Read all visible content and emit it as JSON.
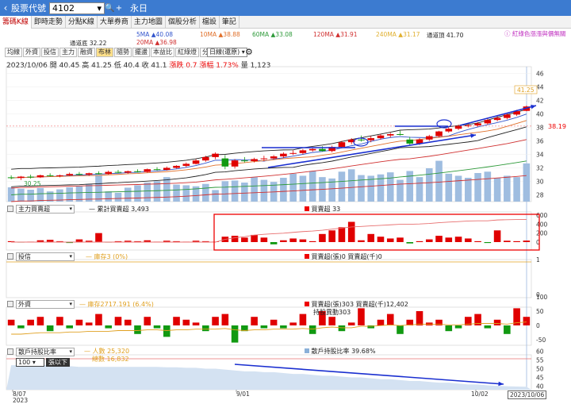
{
  "topbar": {
    "back": "‹",
    "label": "股票代號",
    "code": "4102",
    "stock_name": "永日"
  },
  "tabs": [
    "籌碼K線",
    "即時走勢",
    "分點K線",
    "大單券商",
    "主力地圖",
    "個股分析",
    "檔設",
    "筆記"
  ],
  "ma_legend": {
    "ma5": "5MA ▲40.08",
    "ma10": "10MA ▲38.88",
    "ma60": "60MA ▲33.08",
    "ma120": "120MA ▲31.91",
    "ma240": "240MA ▲31.17",
    "channel_top": "通道頂 41.70",
    "channel_bottom": "通道底 32.22",
    "ma20": "20MA ▲36.98",
    "note": "ⓘ 紅綠色漲漲與價無關"
  },
  "subtabs": [
    "均線",
    "外資",
    "投信",
    "主力",
    "融資",
    "布林",
    "隨勢",
    "擺盪",
    "本益比",
    "紅綠燈",
    "分價量"
  ],
  "period": "日線(還原)",
  "info": {
    "date": "2023/10/06",
    "open": "開 40.45",
    "high": "高 41.25",
    "low": "低 40.4",
    "close": "收 41.1",
    "change": "漲跌 0.7",
    "pct": "漲幅 1.73%",
    "volume": "量 1,123"
  },
  "price_axis": [
    "46",
    "44",
    "42",
    "40",
    "38",
    "36",
    "34",
    "32",
    "30",
    "28"
  ],
  "price_marks": {
    "high_label": "41.25",
    "current": "38.19",
    "low_label": "30.25"
  },
  "panels": {
    "main_force": {
      "select": "主力買賣超",
      "cum_label": "— 累計買賣超 3,493",
      "day_label": "買賣超 33",
      "axis": [
        "600",
        "400",
        "200",
        "0"
      ]
    },
    "trust": {
      "select": "投信",
      "hold_label": "— 庫存3 (0%)",
      "day_label": "買賣超(張)0 買賣超(千)0",
      "axis": [
        "1",
        "0"
      ]
    },
    "foreign": {
      "select": "外資",
      "hold_label": "— 庫存2717.191 (6.4%)",
      "day_label": "買賣超(張)303 買賣超(千)12,402",
      "sub_label": "持股異動303",
      "axis": [
        "100",
        "50",
        "0",
        "-50"
      ]
    },
    "holders": {
      "select": "散戶持股比率",
      "people_label": "— 人數 25,320",
      "total_label": "總數 16,832",
      "ratio_label": "散戶持股比率 39.68%",
      "axis": [
        "60",
        "55",
        "50",
        "45",
        "40"
      ],
      "pct_select": "100",
      "pct_note": "張以下"
    }
  },
  "dates": {
    "d1": "8/07",
    "d1y": "2023",
    "d2": "9/01",
    "d3": "10/02",
    "d4": "2023/10/06"
  },
  "chart_data": {
    "type": "bar",
    "candles": [
      [
        30.6,
        30.9,
        30.3,
        30.5
      ],
      [
        30.5,
        30.8,
        30.2,
        30.7
      ],
      [
        30.7,
        31.0,
        30.4,
        30.6
      ],
      [
        30.6,
        31.0,
        30.5,
        30.9
      ],
      [
        30.9,
        31.2,
        30.7,
        30.8
      ],
      [
        30.8,
        31.0,
        30.6,
        30.9
      ],
      [
        30.9,
        31.3,
        30.8,
        31.1
      ],
      [
        31.1,
        31.4,
        30.9,
        31.0
      ],
      [
        31.0,
        31.3,
        30.8,
        31.2
      ],
      [
        31.2,
        31.5,
        31.0,
        31.1
      ],
      [
        31.1,
        31.6,
        31.0,
        31.4
      ],
      [
        31.4,
        31.7,
        31.2,
        31.3
      ],
      [
        31.3,
        31.6,
        31.1,
        31.5
      ],
      [
        31.5,
        31.8,
        31.3,
        31.4
      ],
      [
        31.4,
        31.9,
        31.3,
        31.8
      ],
      [
        31.8,
        32.1,
        31.6,
        31.7
      ],
      [
        31.7,
        32.2,
        31.6,
        32.0
      ],
      [
        32.0,
        32.4,
        31.9,
        32.3
      ],
      [
        32.3,
        32.8,
        32.1,
        32.6
      ],
      [
        32.6,
        33.3,
        32.5,
        33.1
      ],
      [
        33.1,
        33.8,
        32.9,
        33.6
      ],
      [
        33.6,
        34.3,
        33.3,
        34.1
      ],
      [
        33.4,
        33.9,
        31.8,
        32.2
      ],
      [
        32.2,
        33.3,
        31.9,
        33.1
      ],
      [
        33.1,
        33.6,
        32.8,
        33.0
      ],
      [
        33.0,
        33.5,
        32.8,
        33.3
      ],
      [
        33.3,
        33.8,
        33.0,
        33.4
      ],
      [
        33.4,
        33.9,
        33.2,
        33.7
      ],
      [
        33.7,
        34.3,
        33.5,
        34.1
      ],
      [
        34.1,
        34.6,
        33.9,
        34.2
      ],
      [
        34.2,
        34.8,
        34.0,
        34.6
      ],
      [
        34.6,
        35.0,
        34.4,
        34.8
      ],
      [
        34.8,
        35.2,
        34.4,
        34.5
      ],
      [
        34.5,
        35.3,
        34.3,
        35.1
      ],
      [
        35.1,
        36.0,
        34.9,
        35.8
      ],
      [
        35.8,
        36.4,
        35.5,
        36.2
      ],
      [
        36.2,
        36.8,
        35.9,
        36.1
      ],
      [
        36.1,
        36.7,
        35.8,
        36.4
      ],
      [
        36.4,
        37.0,
        36.2,
        36.8
      ],
      [
        36.8,
        37.2,
        36.5,
        37.0
      ],
      [
        37.0,
        37.5,
        36.8,
        36.9
      ],
      [
        36.2,
        36.6,
        35.3,
        35.6
      ],
      [
        35.6,
        36.4,
        35.4,
        36.2
      ],
      [
        36.2,
        36.9,
        36.0,
        36.7
      ],
      [
        36.7,
        37.5,
        36.5,
        37.4
      ],
      [
        37.4,
        38.0,
        37.2,
        37.8
      ],
      [
        37.8,
        38.4,
        37.6,
        38.2
      ],
      [
        38.2,
        38.6,
        38.0,
        38.3
      ],
      [
        38.3,
        38.8,
        38.1,
        38.6
      ],
      [
        38.6,
        39.3,
        38.4,
        39.1
      ],
      [
        39.1,
        39.7,
        38.9,
        39.4
      ],
      [
        39.4,
        40.1,
        39.2,
        39.9
      ],
      [
        39.9,
        40.6,
        39.7,
        40.4
      ],
      [
        40.45,
        41.25,
        40.4,
        41.1
      ]
    ],
    "volumes": [
      420,
      380,
      350,
      400,
      300,
      360,
      420,
      450,
      520,
      780,
      300,
      260,
      410,
      480,
      560,
      600,
      720,
      500,
      480,
      450,
      520,
      340,
      600,
      620,
      560,
      720,
      640,
      580,
      700,
      820,
      760,
      900,
      720,
      680,
      880,
      950,
      780,
      760,
      800,
      860,
      640,
      900,
      720,
      980,
      1200,
      820,
      760,
      700,
      840,
      880,
      700,
      760,
      720,
      1123
    ],
    "main_force": [
      20,
      -10,
      10,
      40,
      50,
      20,
      -20,
      60,
      30,
      200,
      -10,
      20,
      30,
      20,
      40,
      10,
      30,
      20,
      10,
      30,
      20,
      10,
      120,
      140,
      100,
      160,
      100,
      -50,
      40,
      80,
      60,
      20,
      180,
      260,
      330,
      450,
      40,
      180,
      120,
      80,
      100,
      -30,
      20,
      60,
      140,
      100,
      120,
      80,
      20,
      -20,
      260,
      30,
      20,
      33
    ],
    "main_force_cum": [
      0,
      0,
      0,
      0,
      0,
      0,
      0,
      0,
      0,
      0,
      0,
      0,
      0,
      0,
      0,
      0,
      0,
      0,
      0,
      0,
      0,
      0,
      100,
      160,
      200,
      260,
      290,
      310,
      330,
      360,
      390,
      410,
      440,
      480,
      520,
      560,
      580,
      600,
      620,
      640,
      660,
      660,
      670,
      690,
      720,
      740,
      760,
      780,
      790,
      790,
      820,
      830,
      835,
      840
    ],
    "foreign": [
      20,
      -10,
      20,
      30,
      -20,
      30,
      -10,
      20,
      10,
      40,
      -10,
      30,
      20,
      -30,
      30,
      -10,
      -40,
      30,
      20,
      10,
      -20,
      30,
      40,
      -60,
      -20,
      30,
      -10,
      20,
      -10,
      10,
      40,
      -30,
      50,
      30,
      -20,
      10,
      60,
      -10,
      20,
      40,
      -30,
      20,
      50,
      10,
      20,
      -20,
      -10,
      30,
      40,
      -10,
      20,
      -30,
      60,
      30
    ],
    "foreign_cum": [
      2700,
      2700,
      2701,
      2702,
      2702,
      2702,
      2703,
      2703,
      2704,
      2704,
      2704,
      2705,
      2705,
      2705,
      2706,
      2706,
      2705,
      2706,
      2706,
      2707,
      2707,
      2707,
      2708,
      2706,
      2705,
      2706,
      2706,
      2707,
      2707,
      2707,
      2708,
      2707,
      2709,
      2710,
      2709,
      2709,
      2711,
      2711,
      2712,
      2713,
      2712,
      2713,
      2714,
      2714,
      2714,
      2713,
      2713,
      2714,
      2715,
      2715,
      2715,
      2714,
      2716,
      2717
    ],
    "holder_ratio": [
      52,
      52,
      52,
      52,
      52,
      51.5,
      51.5,
      51,
      51,
      51,
      51,
      51,
      51,
      51,
      51,
      51,
      50.8,
      50.8,
      50.5,
      50.5,
      50,
      50,
      49.5,
      49,
      48.5,
      48.5,
      48,
      48,
      47.5,
      47,
      47,
      46.5,
      46,
      46,
      45.5,
      45,
      45,
      44.5,
      44,
      44,
      43.5,
      43,
      43,
      42.5,
      42,
      42,
      41.5,
      41,
      41,
      40.5,
      40.2,
      40,
      39.8,
      39.68
    ],
    "price_ylim": [
      27,
      47
    ]
  }
}
